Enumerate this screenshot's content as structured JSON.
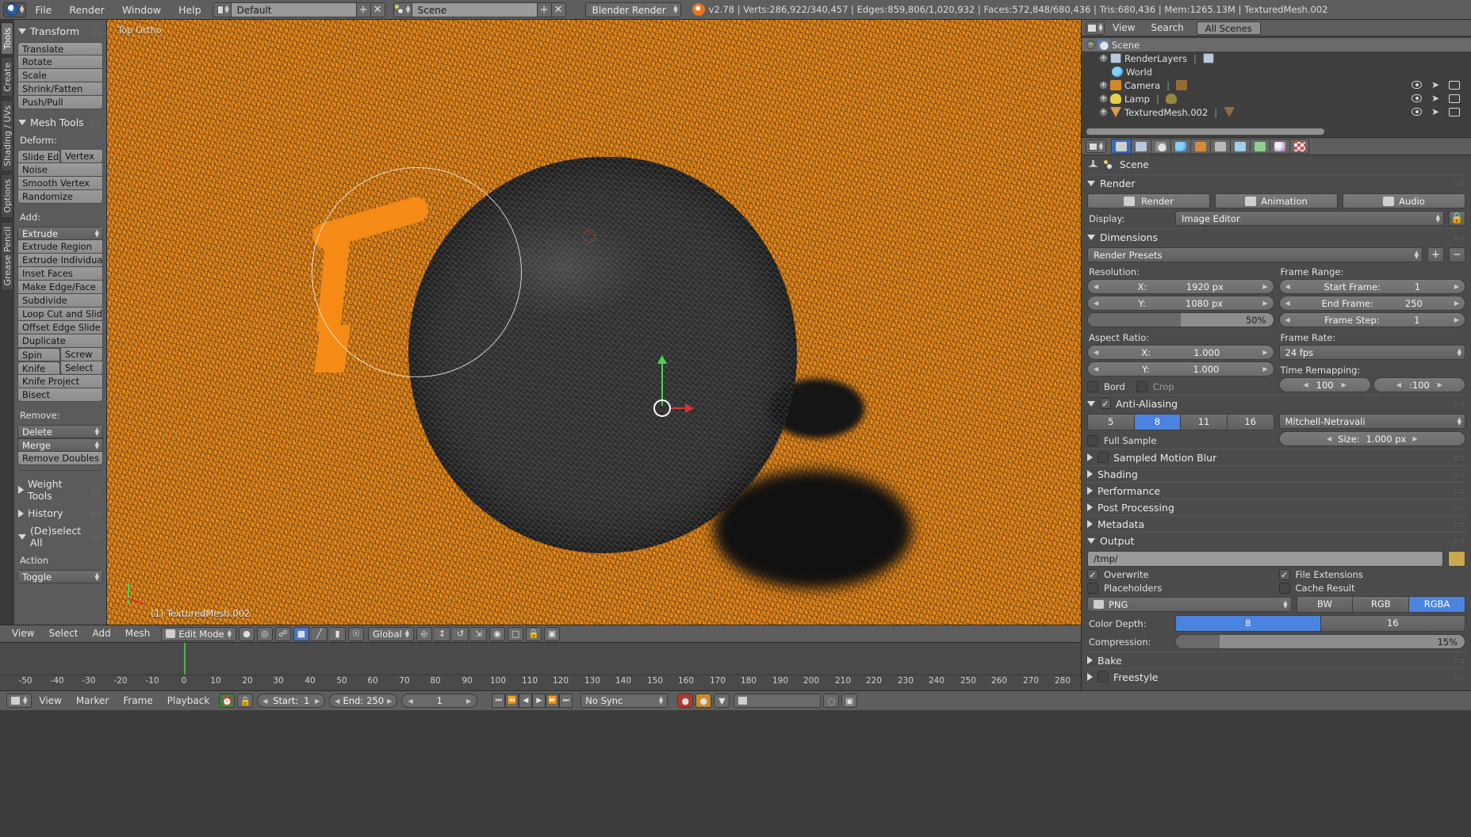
{
  "topbar": {
    "logo_icon": "blender-logo-icon",
    "menus": [
      "File",
      "Render",
      "Window",
      "Help"
    ],
    "screen_layout": {
      "icon": "screen-layout-icon",
      "value": "Default",
      "add_label": "+",
      "delete_label": "✕"
    },
    "scene_select": {
      "icon": "scene-icon",
      "value": "Scene",
      "add_label": "+",
      "delete_label": "✕"
    },
    "render_engine": "Blender Render",
    "status_icon": "blender-status-icon",
    "status": "v2.78 | Verts:286,922/340,457 | Edges:859,806/1,020,932 | Faces:572,848/680,436 | Tris:680,436 | Mem:1265.13M | TexturedMesh.002"
  },
  "toolshelf": {
    "tabs": [
      "Tools",
      "Create",
      "Shading / UVs",
      "Options",
      "Grease Pencil"
    ],
    "active_tab": "Tools",
    "transform": {
      "title": "Transform",
      "buttons": [
        "Translate",
        "Rotate",
        "Scale",
        "Shrink/Fatten",
        "Push/Pull"
      ]
    },
    "mesh_tools": {
      "title": "Mesh Tools",
      "deform_label": "Deform:",
      "deform_row": [
        "Slide Ed",
        "Vertex"
      ],
      "deform_buttons": [
        "Noise",
        "Smooth Vertex",
        "Randomize"
      ],
      "add_label": "Add:",
      "add_dropdown": "Extrude",
      "add_buttons": [
        "Extrude Region",
        "Extrude Individual",
        "Inset Faces",
        "Make Edge/Face",
        "Subdivide",
        "Loop Cut and Slide",
        "Offset Edge Slide",
        "Duplicate"
      ],
      "add_row1": [
        "Spin",
        "Screw"
      ],
      "add_row2": [
        "Knife",
        "Select"
      ],
      "add_buttons2": [
        "Knife Project",
        "Bisect"
      ],
      "remove_label": "Remove:",
      "remove_dropdowns": [
        "Delete",
        "Merge"
      ],
      "remove_buttons": [
        "Remove Doubles"
      ]
    },
    "collapsed": [
      {
        "title": "Weight Tools"
      },
      {
        "title": "History"
      }
    ],
    "deselect": {
      "title": "(De)select All",
      "action_label": "Action",
      "action_value": "Toggle"
    }
  },
  "viewport": {
    "header_text": "Top Ortho",
    "object_text": "(1) TexturedMesh.002",
    "cursor_icon": "3d-cursor-icon",
    "gizmo_icon": "transform-gizmo-icon",
    "mini_axes_icon": "mini-axes-icon"
  },
  "viewport_footer": {
    "menus": [
      "View",
      "Select",
      "Add",
      "Mesh"
    ],
    "mode": "Edit Mode",
    "mode_icon": "edit-mode-icon",
    "orientation": "Global",
    "icons": [
      "viewport-shading-icon",
      "pivot-point-icon",
      "snap-magnet-icon",
      "vertex-select-icon",
      "edge-select-icon",
      "face-select-icon",
      "limit-selection-icon",
      "proportional-edit-icon",
      "manipulator-icon",
      "translate-manip-icon",
      "rotate-manip-icon",
      "scale-manip-icon",
      "layer-icon",
      "lock-icon",
      "render-icon"
    ]
  },
  "timeline": {
    "ticks": [
      "-50",
      "-40",
      "-30",
      "-20",
      "-10",
      "0",
      "10",
      "20",
      "30",
      "40",
      "50",
      "60",
      "70",
      "80",
      "90",
      "100",
      "110",
      "120",
      "130",
      "140",
      "150",
      "160",
      "170",
      "180",
      "190",
      "200",
      "210",
      "220",
      "230",
      "240",
      "250",
      "260",
      "270",
      "280"
    ],
    "playhead_frame": "0",
    "menus": [
      "View",
      "Marker",
      "Frame",
      "Playback"
    ],
    "start_label": "Start:",
    "start_value": "1",
    "end_label": "End:",
    "end_value": "250",
    "current_frame": "1",
    "sync_mode": "No Sync",
    "transport_icons": [
      "jump-to-start-icon",
      "jump-prev-keyframe-icon",
      "play-reverse-icon",
      "play-icon",
      "jump-next-keyframe-icon",
      "jump-to-end-icon"
    ],
    "record_icon": "record-icon",
    "keyingset_icon": "keying-set-icon",
    "ghost_icon": "onion-skin-icon"
  },
  "outliner": {
    "display_mode_icon": "outliner-display-mode-icon",
    "menus": [
      "View",
      "Search"
    ],
    "filter": "All Scenes",
    "rows": [
      {
        "label": "Scene",
        "icon": "scene-icon",
        "indent": 0,
        "selected": true,
        "expander": "−",
        "has_toggles": false
      },
      {
        "label": "RenderLayers",
        "icon": "renderlayers-icon",
        "indent": 1,
        "selected": false,
        "expander": "+",
        "has_toggles": false
      },
      {
        "label": "World",
        "icon": "world-icon",
        "indent": 2,
        "selected": false,
        "expander": "",
        "has_toggles": false
      },
      {
        "label": "Camera",
        "icon": "camera-icon",
        "indent": 1,
        "selected": false,
        "expander": "+",
        "has_toggles": true
      },
      {
        "label": "Lamp",
        "icon": "lamp-icon",
        "indent": 1,
        "selected": false,
        "expander": "+",
        "has_toggles": true
      },
      {
        "label": "TexturedMesh.002",
        "icon": "mesh-icon",
        "indent": 1,
        "selected": false,
        "expander": "+",
        "has_toggles": true
      }
    ],
    "toggle_icons": [
      "eye-icon",
      "cursor-arrow-icon",
      "camera-render-icon"
    ]
  },
  "properties": {
    "tabs": [
      {
        "name": "render-tab",
        "active": true
      },
      {
        "name": "render-layers-tab",
        "active": false
      },
      {
        "name": "scene-tab",
        "active": false
      },
      {
        "name": "world-tab",
        "active": false
      },
      {
        "name": "object-tab",
        "active": false
      },
      {
        "name": "constraints-tab",
        "active": false
      },
      {
        "name": "modifiers-tab",
        "active": false
      },
      {
        "name": "data-tab",
        "active": false
      },
      {
        "name": "material-tab",
        "active": false
      },
      {
        "name": "texture-tab",
        "active": false
      }
    ],
    "breadcrumb": "Scene",
    "render": {
      "title": "Render",
      "buttons": [
        {
          "label": "Render",
          "icon": "render-image-icon"
        },
        {
          "label": "Animation",
          "icon": "render-animation-icon"
        },
        {
          "label": "Audio",
          "icon": "render-audio-icon"
        }
      ],
      "display_label": "Display:",
      "display_value": "Image Editor",
      "display_lock_icon": "lock-interface-icon"
    },
    "dimensions": {
      "title": "Dimensions",
      "presets": "Render Presets",
      "preset_add": "+",
      "preset_remove": "−",
      "resolution_label": "Resolution:",
      "res_x_label": "X:",
      "res_x_value": "1920 px",
      "res_y_label": "Y:",
      "res_y_value": "1080 px",
      "res_percent": "50%",
      "aspect_label": "Aspect Ratio:",
      "aspect_x_label": "X:",
      "aspect_x_value": "1.000",
      "aspect_y_label": "Y:",
      "aspect_y_value": "1.000",
      "border_label": "Bord",
      "crop_label": "Crop",
      "frame_range_label": "Frame Range:",
      "start_frame_label": "Start Frame:",
      "start_frame_value": "1",
      "end_frame_label": "End Frame:",
      "end_frame_value": "250",
      "frame_step_label": "Frame Step:",
      "frame_step_value": "1",
      "frame_rate_label": "Frame Rate:",
      "frame_rate_value": "24 fps",
      "time_remap_label": "Time Remapping:",
      "time_remap_old": "100",
      "time_remap_new": ":100"
    },
    "antialiasing": {
      "title": "Anti-Aliasing",
      "enabled": true,
      "samples": [
        "5",
        "8",
        "11",
        "16"
      ],
      "active_sample": "8",
      "filter": "Mitchell-Netravali",
      "full_sample_label": "Full Sample",
      "size_label": "Size:",
      "size_value": "1.000 px"
    },
    "collapsed_sections": [
      {
        "title": "Sampled Motion Blur",
        "has_checkbox": true
      },
      {
        "title": "Shading",
        "has_checkbox": false
      },
      {
        "title": "Performance",
        "has_checkbox": false
      },
      {
        "title": "Post Processing",
        "has_checkbox": false
      },
      {
        "title": "Metadata",
        "has_checkbox": false
      }
    ],
    "output": {
      "title": "Output",
      "path": "/tmp/",
      "browse_icon": "folder-browse-icon",
      "overwrite_label": "Overwrite",
      "file_extensions_label": "File Extensions",
      "placeholders_label": "Placeholders",
      "cache_result_label": "Cache Result",
      "format": "PNG",
      "format_icon": "image-format-icon",
      "color_modes": [
        "BW",
        "RGB",
        "RGBA"
      ],
      "active_color_mode": "RGBA",
      "color_depth_label": "Color Depth:",
      "color_depths": [
        "8",
        "16"
      ],
      "active_color_depth": "8",
      "compression_label": "Compression:",
      "compression_value": "15%"
    },
    "bottom_sections": [
      {
        "title": "Bake"
      },
      {
        "title": "Freestyle",
        "has_checkbox": true
      }
    ]
  },
  "colors": {
    "accent_blue": "#4a84e0",
    "orange_mesh": "#f38b11",
    "panel_bg": "#4b4b4b",
    "header_bg": "#5e5e5e"
  }
}
